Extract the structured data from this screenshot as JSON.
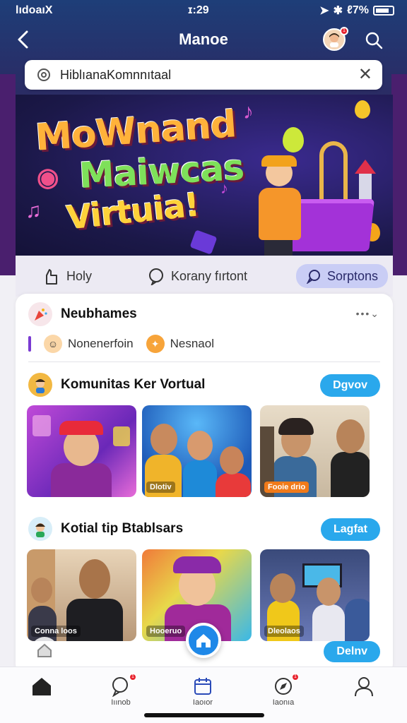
{
  "status_bar": {
    "carrier": "lıdoaıX",
    "time": "ɪ:29",
    "battery": "ℓ7%"
  },
  "header": {
    "title": "Manoe",
    "back_icon": "chevron-left-icon",
    "notification_count": "1"
  },
  "search": {
    "value": "HiblıanaKomnnıtaal",
    "placeholder": ""
  },
  "banner": {
    "line1": "MoWnand",
    "line2": "Maiwcas",
    "line3": "Virtuia!"
  },
  "tabs": [
    {
      "label": "Holy",
      "icon": "hand-icon",
      "active": false
    },
    {
      "label": "Korany fırtont",
      "icon": "chat-bubble-icon",
      "active": false
    },
    {
      "label": "Sorptons",
      "icon": "chat-icon",
      "active": true
    }
  ],
  "section_neighborhood": {
    "title": "Neubhames",
    "chips": [
      {
        "label": "Nonenerfoin"
      },
      {
        "label": "Nesnaol"
      }
    ]
  },
  "section_community": {
    "title": "Komunitas Ker Vortual",
    "action": "Dgvov",
    "photos": [
      {
        "label": ""
      },
      {
        "label": "Dlotiv"
      },
      {
        "label": "Fooie drio"
      }
    ]
  },
  "section_tips": {
    "title": "Kotial tip Btablsars",
    "action": "Lagfat",
    "photos": [
      {
        "label": "Conna loos"
      },
      {
        "label": "Hooeruo"
      },
      {
        "label": "Dleolaos"
      }
    ],
    "more_action": "Delnv"
  },
  "bottom_nav": [
    {
      "label": "",
      "icon": "home-icon"
    },
    {
      "label": "Iıınob",
      "icon": "chat-search-icon",
      "badge": "1"
    },
    {
      "label": "Iaoıor",
      "icon": "calendar-icon"
    },
    {
      "label": "Iaonıa",
      "icon": "compass-icon",
      "badge": "1"
    },
    {
      "label": "",
      "icon": "profile-icon"
    }
  ],
  "colors": {
    "header": "#1e3e78",
    "accent": "#2aa8ec",
    "active_tab": "#c9cdf5",
    "badge": "#e8232e"
  }
}
